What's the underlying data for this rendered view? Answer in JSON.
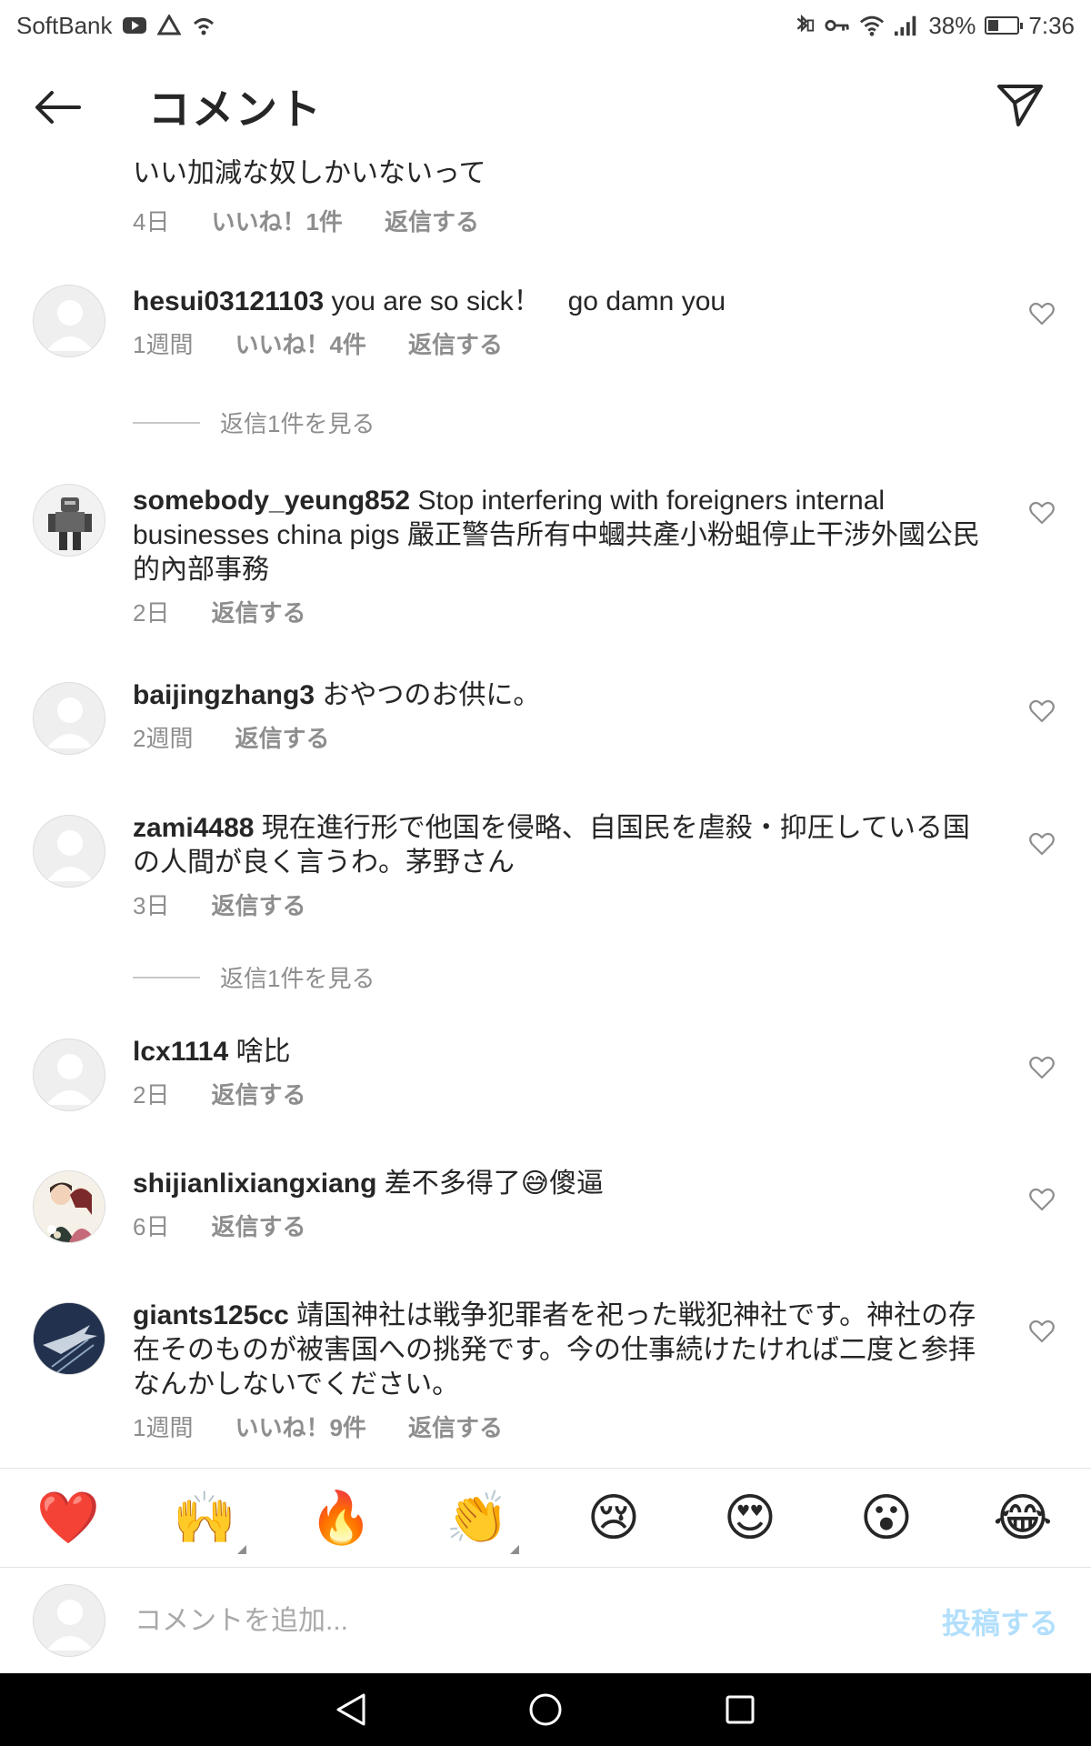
{
  "status_bar": {
    "carrier": "SoftBank",
    "battery_percent": "38%",
    "battery_level": 0.38,
    "time": "7:36",
    "icons_left": [
      "youtube-icon",
      "drive-icon",
      "wifi-assist-icon"
    ],
    "icons_right": [
      "bluetooth-vibrate-icon",
      "key-icon",
      "wifi-icon",
      "signal-icon",
      "battery-icon"
    ]
  },
  "header": {
    "title": "コメント",
    "back_icon": "arrow-left-icon",
    "send_icon": "paper-plane-icon"
  },
  "comments": [
    {
      "username": "",
      "text": "いい加減な奴しかいないって",
      "time": "4日",
      "likes": "いいね！1件",
      "reply": "返信する",
      "has_avatar": false,
      "has_heart": false
    },
    {
      "username": "hesui03121103",
      "text": "you are so sick！　go damn you",
      "time": "1週間",
      "likes": "いいね！4件",
      "reply": "返信する",
      "has_avatar": true,
      "has_heart": true
    },
    {
      "username": "somebody_yeung852",
      "text": "Stop interfering with foreigners internal businesses china pigs 嚴正警告所有中蟈共產小粉蛆停止干涉外國公民的內部事務",
      "time": "2日",
      "likes": "",
      "reply": "返信する",
      "has_avatar": true,
      "has_heart": true
    },
    {
      "username": "baijingzhang3",
      "text": "おやつのお供に。",
      "time": "2週間",
      "likes": "",
      "reply": "返信する",
      "has_avatar": true,
      "has_heart": true
    },
    {
      "username": "zami4488",
      "text": "現在進行形で他国を侵略、自国民を虐殺・抑圧している国の人間が良く言うわ。茅野さん",
      "time": "3日",
      "likes": "",
      "reply": "返信する",
      "has_avatar": true,
      "has_heart": true
    },
    {
      "username": "lcx1114",
      "text": "啥比",
      "time": "2日",
      "likes": "",
      "reply": "返信する",
      "has_avatar": true,
      "has_heart": true
    },
    {
      "username": "shijianlixiangxiang",
      "text": "差不多得了😅傻逼",
      "time": "6日",
      "likes": "",
      "reply": "返信する",
      "has_avatar": true,
      "has_heart": true
    },
    {
      "username": "giants125cc",
      "text": "靖国神社は戦争犯罪者を祀った戦犯神社です。神社の存在そのものが被害国への挑発です。今の仕事続けたければ二度と参拝なんかしないでください。",
      "time": "1週間",
      "likes": "いいね！9件",
      "reply": "返信する",
      "has_avatar": true,
      "has_heart": true
    }
  ],
  "view_replies": [
    {
      "label": "返信1件を見る"
    },
    {
      "label": "返信1件を見る"
    }
  ],
  "reactions": [
    {
      "emoji": "❤️",
      "icon": "red-heart-emoji"
    },
    {
      "emoji": "🙌",
      "icon": "raising-hands-emoji",
      "has_variants": true
    },
    {
      "emoji": "🔥",
      "icon": "fire-emoji"
    },
    {
      "emoji": "👏",
      "icon": "clapping-hands-emoji",
      "has_variants": true
    },
    {
      "emoji": "😢",
      "icon": "crying-face-emoji"
    },
    {
      "emoji": "😍",
      "icon": "heart-eyes-emoji"
    },
    {
      "emoji": "😮",
      "icon": "surprised-face-emoji"
    },
    {
      "emoji": "😂",
      "icon": "tears-of-joy-emoji"
    }
  ],
  "composer": {
    "placeholder": "コメントを追加...",
    "post_label": "投稿する"
  },
  "nav": {
    "back": "triangle-back-icon",
    "home": "circle-home-icon",
    "recent": "square-recents-icon"
  },
  "colors": {
    "text": "#262626",
    "secondary": "#8e8e8e",
    "post_disabled": "#b2dffc",
    "heart_red": "#ed4956"
  }
}
